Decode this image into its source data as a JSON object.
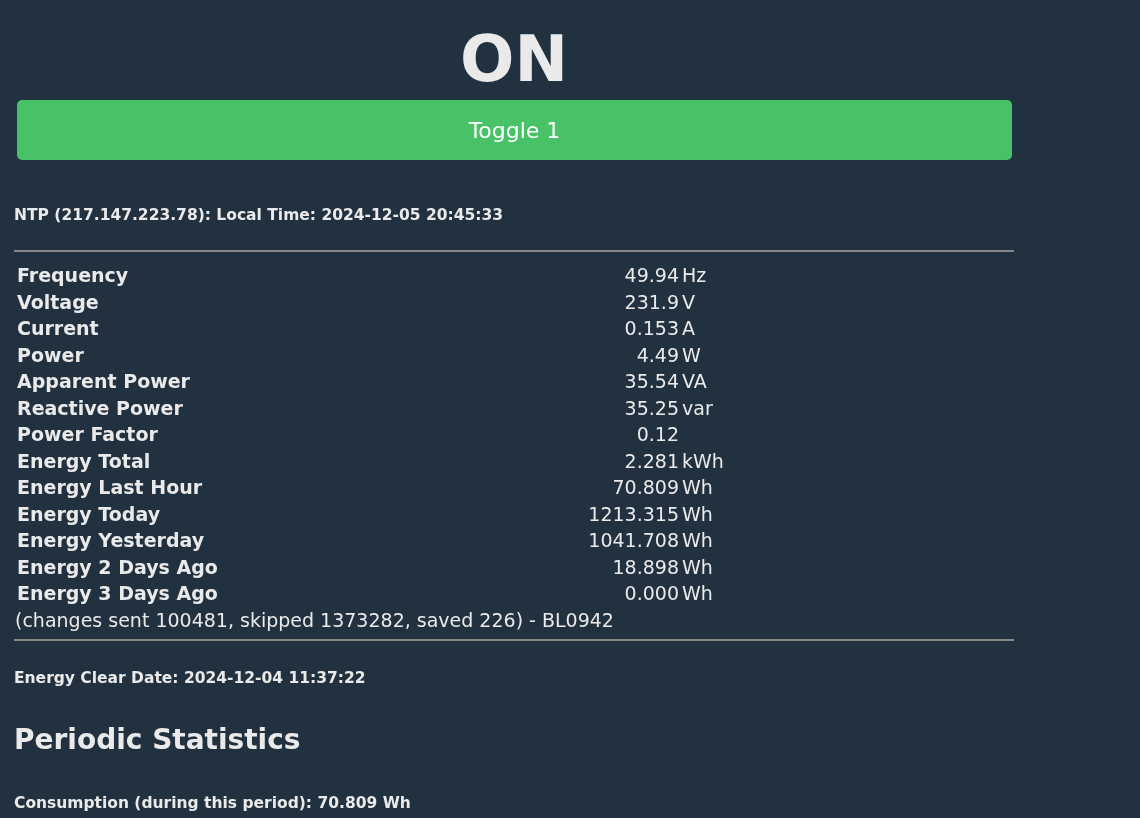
{
  "state": "ON",
  "toggle_button": "Toggle 1",
  "ntp_line": "NTP (217.147.223.78): Local Time: 2024-12-05 20:45:33",
  "readings": [
    {
      "label": "Frequency",
      "value": "49.94",
      "unit": "Hz"
    },
    {
      "label": "Voltage",
      "value": "231.9",
      "unit": "V"
    },
    {
      "label": "Current",
      "value": "0.153",
      "unit": "A"
    },
    {
      "label": "Power",
      "value": "4.49",
      "unit": "W"
    },
    {
      "label": "Apparent Power",
      "value": "35.54",
      "unit": "VA"
    },
    {
      "label": "Reactive Power",
      "value": "35.25",
      "unit": "var"
    },
    {
      "label": "Power Factor",
      "value": "0.12"
    },
    {
      "label": "Energy Total",
      "value": "2.281",
      "unit": "kWh"
    },
    {
      "label": "Energy Last Hour",
      "value": "70.809",
      "unit": "Wh"
    },
    {
      "label": "Energy Today",
      "value": "1213.315",
      "unit": "Wh"
    },
    {
      "label": "Energy Yesterday",
      "value": "1041.708",
      "unit": "Wh"
    },
    {
      "label": "Energy 2 Days Ago",
      "value": "18.898",
      "unit": "Wh"
    },
    {
      "label": "Energy 3 Days Ago",
      "value": "0.000",
      "unit": "Wh"
    }
  ],
  "changes_note": "(changes sent 100481, skipped 1373282, saved 226) - BL0942",
  "clear_date": "Energy Clear Date: 2024-12-04 11:37:22",
  "periodic_heading": "Periodic Statistics",
  "consumption": "Consumption (during this period): 70.809 Wh"
}
